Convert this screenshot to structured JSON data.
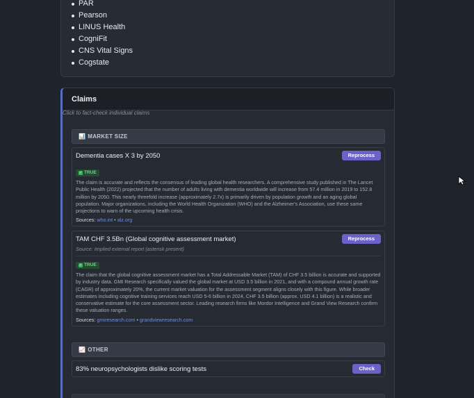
{
  "vendors": [
    "PAR",
    "Pearson",
    "LINUS Health",
    "CogniFit",
    "CNS Vital Signs",
    "Cogstate"
  ],
  "claims": {
    "title": "Claims",
    "hint": "Click to fact-check individual claims",
    "sections": {
      "market_size": {
        "icon": "📊",
        "label": "MARKET SIZE",
        "items": [
          {
            "title": "Dementia cases X 3 by 2050",
            "button": "Reprocess",
            "verdict": "TRUE",
            "body": "The claim is accurate and reflects the consensus of leading global health researchers. A comprehensive study published in The Lancet Public Health (2022) projected that the number of adults living with dementia worldwide will increase from 57.4 million in 2019 to 152.8 million by 2050. This nearly threefold increase (approximately 2.7x) is primarily driven by population growth and an aging global population. Major organizations, including the World Health Organization (WHO) and the Alzheimer's Association, use these same projections to warn of the upcoming health crisis.",
            "sources_label": "Sources:",
            "sources": [
              "who.int",
              "alz.org"
            ],
            "separator": "•"
          },
          {
            "title": "TAM CHF 3.5Bn (Global cognitive assessment market)",
            "button": "Reprocess",
            "source_note": "Source: Implied external report (asterisk present)",
            "verdict": "TRUE",
            "body": "The claim that the global cognitive assessment market has a Total Addressable Market (TAM) of CHF 3.5 billion is accurate and supported by industry data. GMI Research specifically valued the global market at USD 3.5 billion in 2021, and with a compound annual growth rate (CAGR) of approximately 20%, the current market valuation for the assessment segment aligns closely with this figure. While broader estimates including cognitive training services reach USD 5-6 billion in 2024, CHF 3.5 billion (approx. USD 4.1 billion) is a realistic and conservative estimate for the core assessment sector. Leading research firms like Mordor Intelligence and Grand View Research confirm these valuation ranges.",
            "sources_label": "Sources:",
            "sources": [
              "gmiresearch.com",
              "grandviewresearch.com"
            ],
            "separator": "•"
          }
        ]
      },
      "other": {
        "icon": "📈",
        "label": "OTHER",
        "items": [
          {
            "title": "83% neuropsychologists dislike scoring tests",
            "button": "Check"
          }
        ]
      }
    }
  },
  "colors": {
    "accent": "#4f6fd6",
    "button": "#6a62c9",
    "true_badge": "#6fd28a",
    "link": "#6b8fe6"
  }
}
